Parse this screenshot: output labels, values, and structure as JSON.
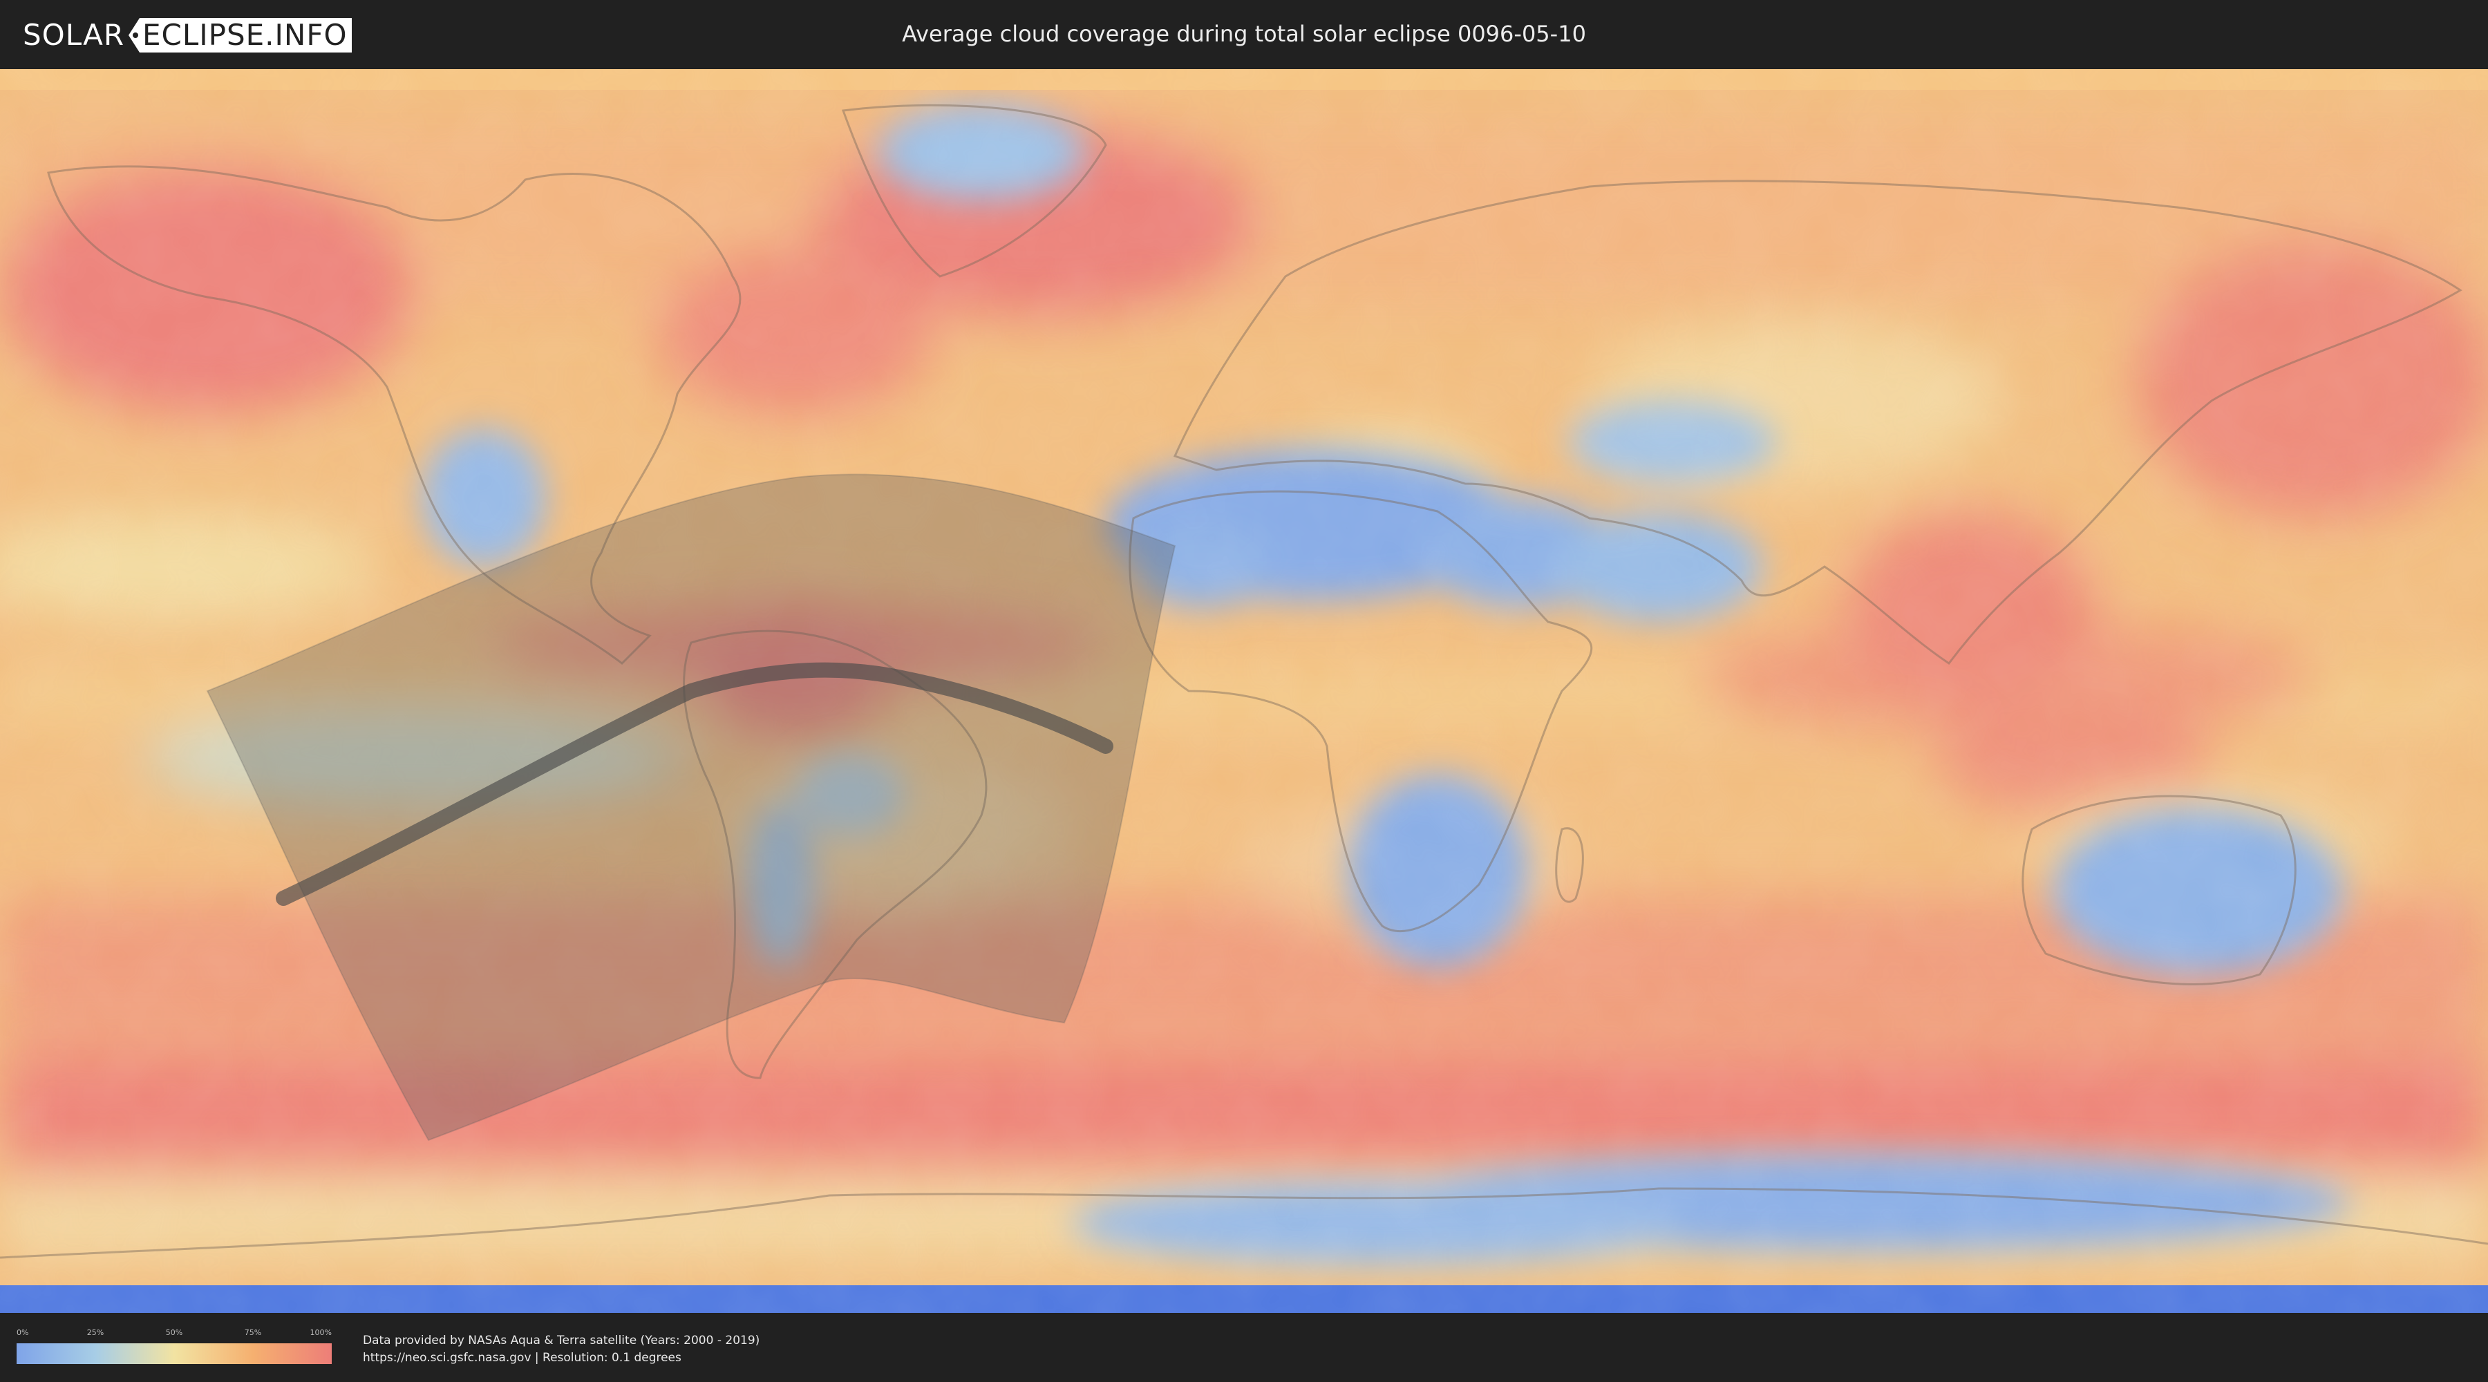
{
  "header": {
    "logo_left": "SOLAR",
    "logo_right": "ECLIPSE.INFO",
    "title": "Average cloud coverage during total solar eclipse 0096-05-10"
  },
  "map": {
    "eclipse_date": "0096-05-10",
    "palette": {
      "clear": "#7fa4e8",
      "low": "#a7cde6",
      "mid": "#f2e3a2",
      "high": "#f5b070",
      "overcast": "#ed7e78",
      "shadow": "#5a5a5a"
    }
  },
  "legend": {
    "ticks": [
      "0%",
      "25%",
      "50%",
      "75%",
      "100%"
    ],
    "colors": [
      "#7fa4e8",
      "#a7cde6",
      "#f2e3a2",
      "#f5b070",
      "#ed7e78"
    ]
  },
  "footer": {
    "source_line": "Data provided by NASAs Aqua & Terra satellite (Years: 2000 - 2019)",
    "info_line": "https://neo.sci.gsfc.nasa.gov | Resolution: 0.1 degrees"
  }
}
